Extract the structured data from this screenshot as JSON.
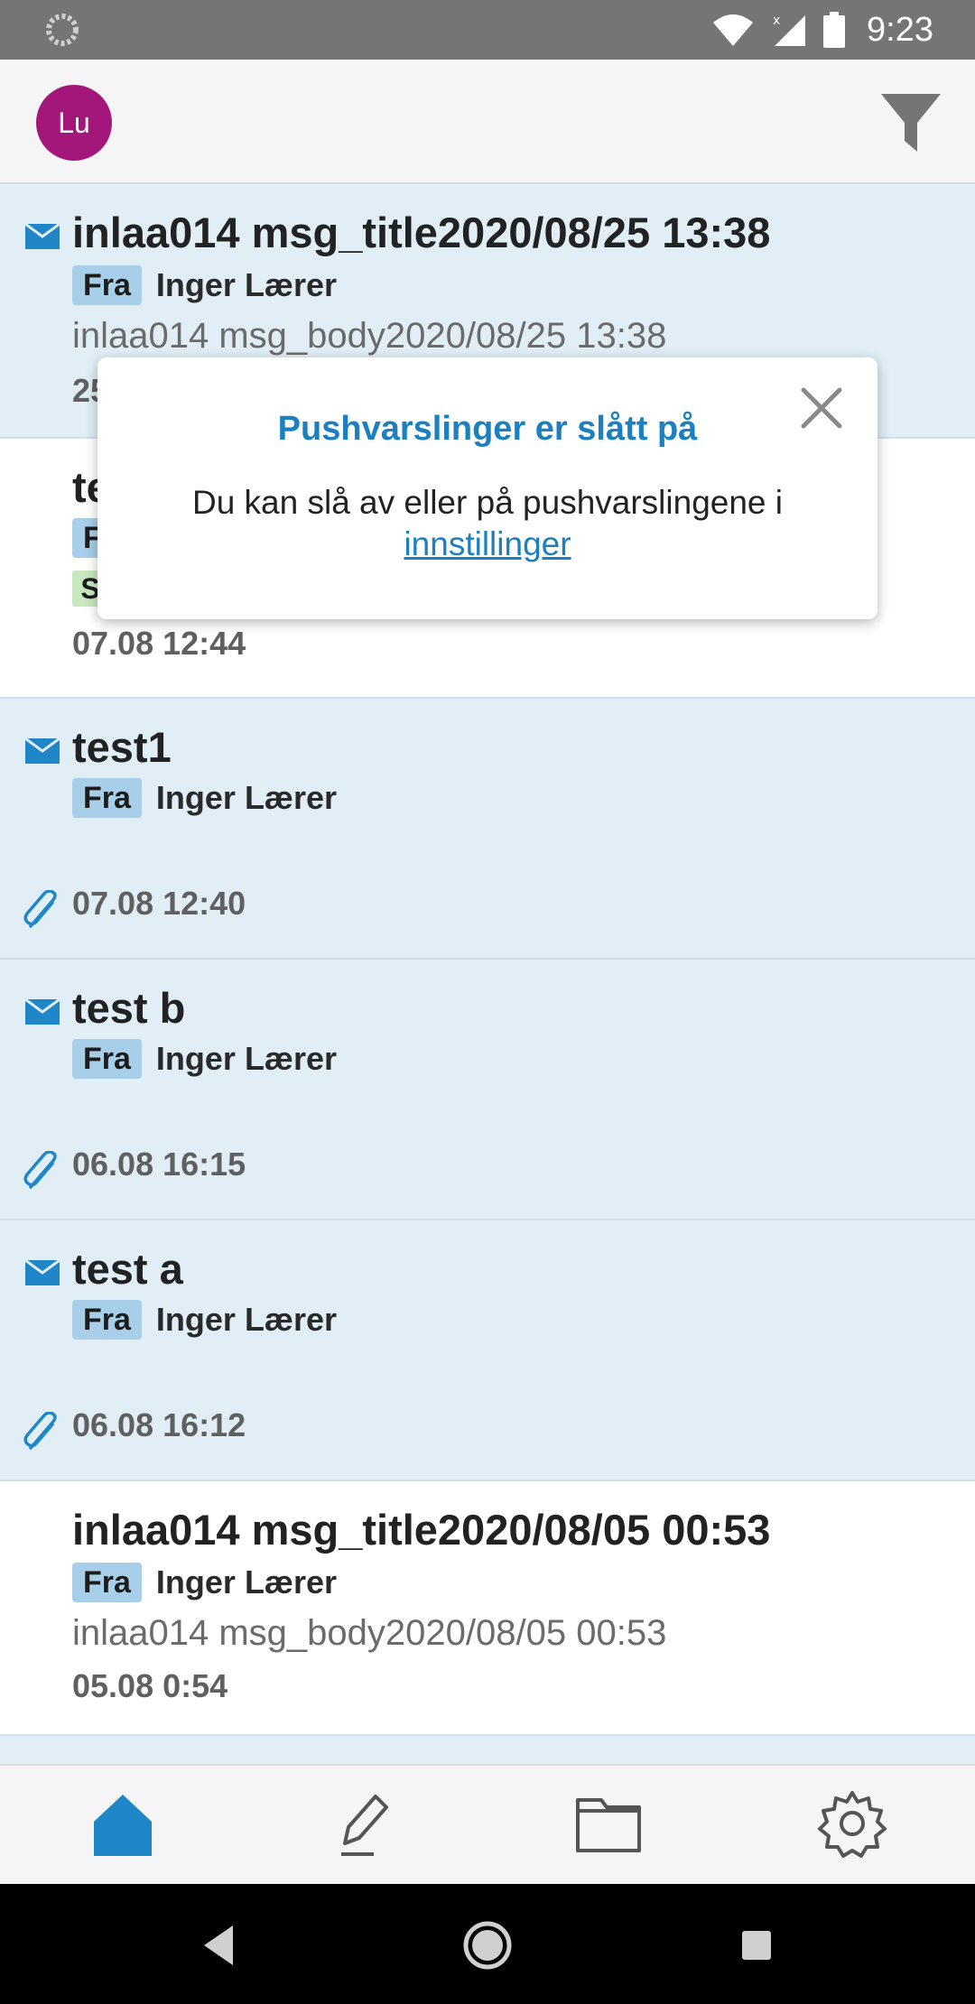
{
  "status_bar": {
    "time": "9:23",
    "icons": [
      "loading-icon",
      "wifi-icon",
      "signal-icon",
      "battery-icon"
    ]
  },
  "header": {
    "avatar_initials": "Lu",
    "avatar_color": "#a3177a",
    "filter_icon": "filter-icon"
  },
  "messages": [
    {
      "title": "inlaa014 msg_title2020/08/25 13:38",
      "from_label": "Fra",
      "from_name": "Inger Lærer",
      "body": "inlaa014 msg_body2020/08/25 13:38",
      "date_partial": "25",
      "unread": true
    },
    {
      "title_partial": "te",
      "from_partial": "F",
      "tag_partial": "S",
      "date": "07.08 12:44",
      "unread": false
    },
    {
      "title": "test1",
      "from_label": "Fra",
      "from_name": "Inger Lærer",
      "date": "07.08 12:40",
      "attachment": true,
      "unread": true
    },
    {
      "title": "test b",
      "from_label": "Fra",
      "from_name": "Inger Lærer",
      "date": "06.08 16:15",
      "attachment": true,
      "unread": true
    },
    {
      "title": "test a",
      "from_label": "Fra",
      "from_name": "Inger Lærer",
      "date": "06.08 16:12",
      "attachment": true,
      "unread": true
    },
    {
      "title": "inlaa014 msg_title2020/08/05 00:53",
      "from_label": "Fra",
      "from_name": "Inger Lærer",
      "body": "inlaa014 msg_body2020/08/05 00:53",
      "date": "05.08 0:54",
      "unread": false
    }
  ],
  "popup": {
    "title": "Pushvarslinger er slått på",
    "text": "Du kan slå av eller på pushvarslingene i",
    "link": "innstillinger"
  },
  "bottom_nav": {
    "items": [
      "home-icon",
      "compose-icon",
      "folder-icon",
      "settings-icon"
    ],
    "active": "home-icon"
  },
  "colors": {
    "accent": "#1b7fc0",
    "unread_bg": "#e1eef6",
    "badge_bg": "#a7cfe9"
  }
}
